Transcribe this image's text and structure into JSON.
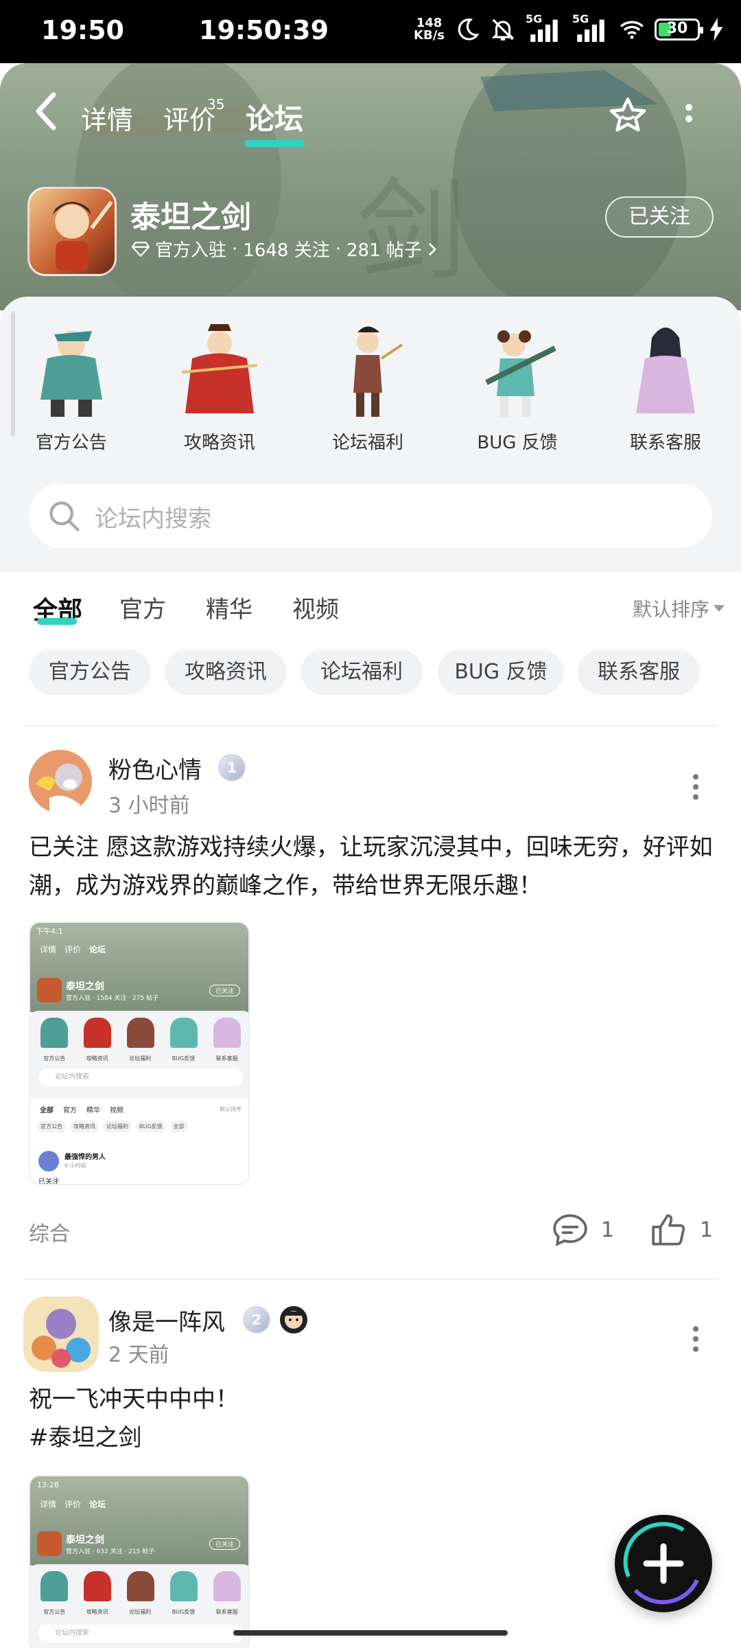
{
  "status_bar": {
    "time": "19:50",
    "clock": "19:50:39",
    "net_speed_value": "148",
    "net_speed_unit": "KB/s",
    "battery": "30",
    "signal_label_1": "5G",
    "signal_label_2": "5G"
  },
  "header": {
    "tabs": [
      "详情",
      "评价",
      "论坛"
    ],
    "review_count": "35",
    "active_tab": "论坛"
  },
  "game": {
    "name": "泰坦之剑",
    "verified": "官方入驻",
    "followers": "1648 关注",
    "posts": "281 帖子",
    "follow_label": "已关注"
  },
  "categories": [
    "官方公告",
    "攻略资讯",
    "论坛福利",
    "BUG 反馈",
    "联系客服"
  ],
  "search": {
    "placeholder": "论坛内搜索"
  },
  "filter_tabs": [
    "全部",
    "官方",
    "精华",
    "视频"
  ],
  "sort_label": "默认排序",
  "chips": [
    "官方公告",
    "攻略资讯",
    "论坛福利",
    "BUG 反馈",
    "联系客服"
  ],
  "posts": [
    {
      "author": "粉色心情",
      "level": "1",
      "time": "3 小时前",
      "text": "已关注 愿这款游戏持续火爆，让玩家沉浸其中，回味无穷，好评如潮，成为游戏界的巅峰之作，带给世界无限乐趣！",
      "tag": "综合",
      "comments": "1",
      "likes": "1",
      "shot": {
        "time": "下午4:1",
        "tabs": [
          "详情",
          "评价",
          "论坛"
        ],
        "name": "泰坦之剑",
        "meta": "官方入驻 · 1584 关注 · 275 帖子",
        "follow": "已关注",
        "cats": [
          "官方公告",
          "攻略资讯",
          "论坛福利",
          "BUG反馈",
          "联系客服"
        ],
        "search": "论坛内搜索",
        "ftabs": [
          "全部",
          "官方",
          "精华",
          "视频"
        ],
        "sort": "默认排序",
        "chips": [
          "官方公告",
          "攻略资讯",
          "论坛福利",
          "BUG反馈",
          "全部"
        ],
        "user": "最强悍的男人",
        "utime": "6 小时前",
        "snippet": "已关注"
      }
    },
    {
      "author": "像是一阵风",
      "level": "2",
      "time": "2 天前",
      "text_line1": "祝一飞冲天中中中！",
      "text_line2": "#泰坦之剑",
      "shot": {
        "time": "13:28",
        "tabs": [
          "详情",
          "评价",
          "论坛"
        ],
        "name": "泰坦之剑",
        "meta": "官方入驻 · 632 关注 · 215 帖子",
        "follow": "已关注",
        "cats": [
          "官方公告",
          "攻略资讯",
          "论坛福利",
          "BUG反馈",
          "联系客服"
        ],
        "search": "论坛内搜索"
      }
    }
  ],
  "colors": {
    "accent": "#2fd3c1",
    "hero": "#879a86",
    "panel": "#f3f4f6"
  }
}
